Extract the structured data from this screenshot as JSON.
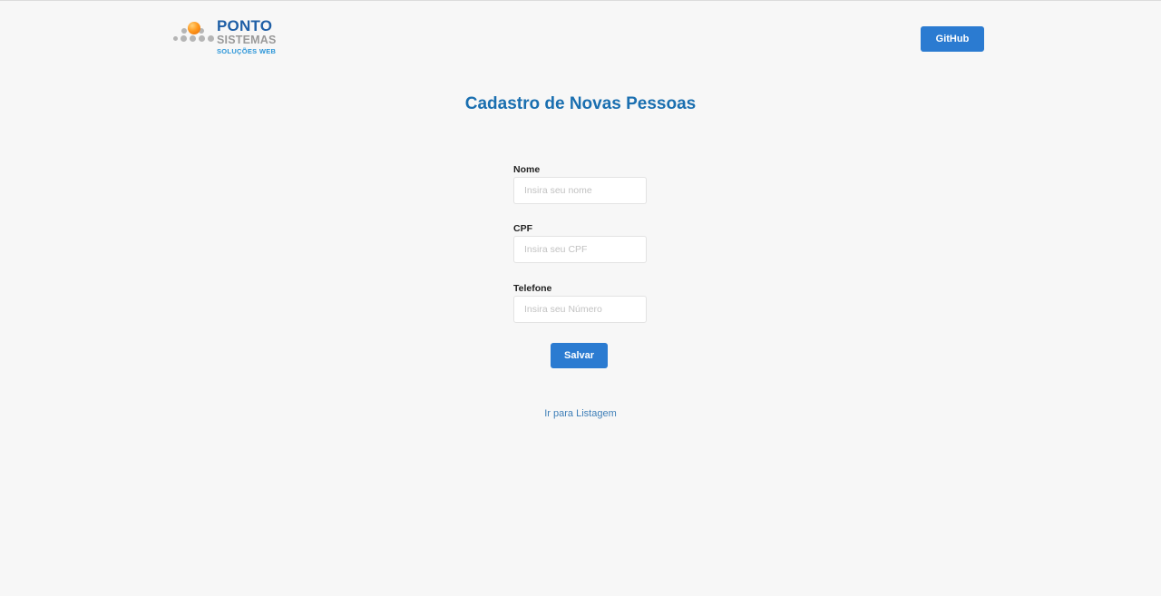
{
  "header": {
    "logo": {
      "line1": "PONTO",
      "line2": "SISTEMAS",
      "line3": "SOLUÇÕES WEB"
    },
    "github_label": "GitHub"
  },
  "page": {
    "title": "Cadastro de Novas Pessoas"
  },
  "form": {
    "nome": {
      "label": "Nome",
      "placeholder": "Insira seu nome",
      "value": ""
    },
    "cpf": {
      "label": "CPF",
      "placeholder": "Insira seu CPF",
      "value": ""
    },
    "telefone": {
      "label": "Telefone",
      "placeholder": "Insira seu Número",
      "value": ""
    },
    "save_label": "Salvar"
  },
  "footer_link": {
    "label": "Ir para Listagem"
  },
  "colors": {
    "accent": "#2b7bd1",
    "title": "#1a6fb0",
    "background": "#f7f7f7"
  }
}
